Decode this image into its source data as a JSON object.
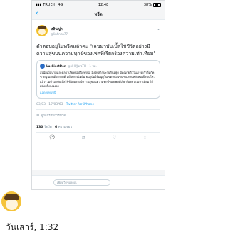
{
  "status": {
    "carrier": "TRUE-H",
    "network": "4G",
    "time": "12:48",
    "battery": "38%"
  },
  "nav": {
    "back_icon": "chevron-left",
    "title": "ทวีต"
  },
  "tweet": {
    "author_name": "หลินญ่า",
    "author_handle": "@linhnha77",
    "text": "คำตอบอยู่ในทวีตแล้วคะ \"เลขมาบับเบิ้ลใช้ชีวิตอย่างมีความสุขบนความทุกข์ของเพศที่เรียกร้องความเท่าเทียม\"",
    "quote": {
      "author_name": "LuckiestDon",
      "author_handle": "@NHUJaraTH",
      "age": "· 1 ชม.",
      "text": "ส่งนัมเบิ้ลนามและผลอวเรียหนัญถือเทรนัส มิงใหล่ก์กนะในกันอยู่ด มิคุณกุยตัวในเกรด ก้าดิ้มกัคชาดนุนเถนต้องกาดดี แต้วประณิตติม ยนๆนั่มให้มนุดูในเขตหนังแข่นฯ แต่คนหลังหมเข็ยบ่นใหวแล้วร่วมทำมาบับเบิ้ลใช้ชีวิตอย่างมีความสุขบนความทุกข์ของเพศที่เรียกร้องความเท่าเทียม ได้มนัด ดิ้งจงจงจง",
      "more": "แสดงบทบทนี้"
    },
    "time": "03/03 · 17/03/63",
    "source": "Twitter for iPhone",
    "activity": "ดูกิจกรรมการทวีต",
    "retweets": "130",
    "retweets_label": "รีทวีต",
    "likes": "6",
    "likes_label": "ความชอบ"
  },
  "reply": {
    "placeholder": "เพิ่มทวีตของคุณ"
  },
  "message": {
    "timestamp": "วันเสาร์, 1:32"
  }
}
